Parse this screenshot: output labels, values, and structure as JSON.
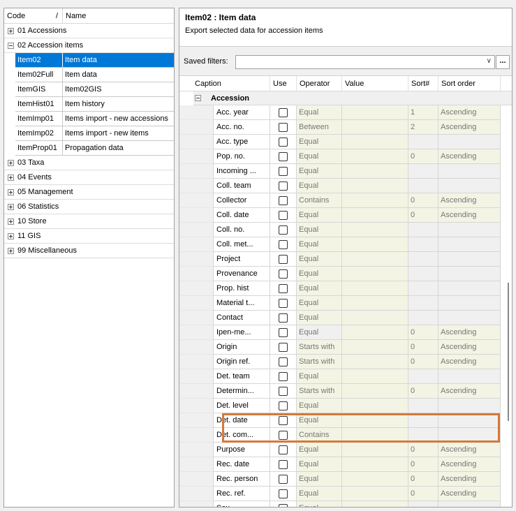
{
  "left_panel": {
    "col_code": "Code",
    "col_sort_mark": "/",
    "col_name": "Name",
    "groups_before": [
      {
        "label": "01 Accessions",
        "expanded": false
      }
    ],
    "expanded_group": {
      "label": "02 Accession items",
      "items": [
        {
          "code": "Item02",
          "name": "Item data",
          "selected": true
        },
        {
          "code": "Item02Full",
          "name": "Item data"
        },
        {
          "code": "ItemGIS",
          "name": "Item02GIS"
        },
        {
          "code": "ItemHist01",
          "name": "Item history"
        },
        {
          "code": "ItemImp01",
          "name": "Items import - new accessions"
        },
        {
          "code": "ItemImp02",
          "name": "Items import - new items"
        },
        {
          "code": "ItemProp01",
          "name": "Propagation data"
        }
      ]
    },
    "groups_after": [
      {
        "label": "03 Taxa"
      },
      {
        "label": "04 Events"
      },
      {
        "label": "05 Management"
      },
      {
        "label": "06 Statistics"
      },
      {
        "label": "10 Store"
      },
      {
        "label": "11 GIS"
      },
      {
        "label": "99 Miscellaneous"
      }
    ]
  },
  "right_panel": {
    "title": "Item02 : Item data",
    "subtitle": "Export selected data for accession items",
    "saved_filters_label": "Saved filters:",
    "more_button": "...",
    "chevron": "∨",
    "grid": {
      "headers": {
        "caption": "Caption",
        "use": "Use",
        "operator": "Operator",
        "value": "Value",
        "sort": "Sort#",
        "order": "Sort order"
      },
      "group": "Accession",
      "rows": [
        {
          "caption": "Acc. year",
          "operator": "Equal",
          "sort": "1",
          "order": "Ascending"
        },
        {
          "caption": "Acc. no.",
          "operator": "Between",
          "sort": "2",
          "order": "Ascending"
        },
        {
          "caption": "Acc. type",
          "operator": "Equal",
          "sort": "",
          "order": ""
        },
        {
          "caption": "Pop. no.",
          "operator": "Equal",
          "sort": "0",
          "order": "Ascending"
        },
        {
          "caption": "Incoming ...",
          "operator": "Equal",
          "sort": "",
          "order": ""
        },
        {
          "caption": "Coll. team",
          "operator": "Equal",
          "sort": "",
          "order": ""
        },
        {
          "caption": "Collector",
          "operator": "Contains",
          "sort": "0",
          "order": "Ascending"
        },
        {
          "caption": "Coll. date",
          "operator": "Equal",
          "sort": "0",
          "order": "Ascending"
        },
        {
          "caption": "Coll. no.",
          "operator": "Equal",
          "sort": "",
          "order": ""
        },
        {
          "caption": "Coll. met...",
          "operator": "Equal",
          "sort": "",
          "order": ""
        },
        {
          "caption": "Project",
          "operator": "Equal",
          "sort": "",
          "order": ""
        },
        {
          "caption": "Provenance",
          "operator": "Equal",
          "sort": "",
          "order": ""
        },
        {
          "caption": "Prop. hist",
          "operator": "Equal",
          "sort": "",
          "order": ""
        },
        {
          "caption": "Material t...",
          "operator": "Equal",
          "sort": "",
          "order": ""
        },
        {
          "caption": "Contact",
          "operator": "Equal",
          "sort": "",
          "order": ""
        },
        {
          "caption": "Ipen-me...",
          "operator": "Equal",
          "sort": "0",
          "order": "Ascending",
          "opgray": true
        },
        {
          "caption": "Origin",
          "operator": "Starts with",
          "sort": "0",
          "order": "Ascending"
        },
        {
          "caption": "Origin ref.",
          "operator": "Starts with",
          "sort": "0",
          "order": "Ascending"
        },
        {
          "caption": "Det. team",
          "operator": "Equal",
          "sort": "",
          "order": ""
        },
        {
          "caption": "Determin...",
          "operator": "Starts with",
          "sort": "0",
          "order": "Ascending"
        },
        {
          "caption": "Det. level",
          "operator": "Equal",
          "sort": "",
          "order": ""
        },
        {
          "caption": "Det. date",
          "operator": "Equal",
          "sort": "",
          "order": ""
        },
        {
          "caption": "Det. com...",
          "operator": "Contains",
          "sort": "",
          "order": ""
        },
        {
          "caption": "Purpose",
          "operator": "Equal",
          "sort": "0",
          "order": "Ascending"
        },
        {
          "caption": "Rec. date",
          "operator": "Equal",
          "sort": "0",
          "order": "Ascending"
        },
        {
          "caption": "Rec. person",
          "operator": "Equal",
          "sort": "0",
          "order": "Ascending"
        },
        {
          "caption": "Rec. ref.",
          "operator": "Equal",
          "sort": "0",
          "order": "Ascending"
        },
        {
          "caption": "Sex",
          "operator": "Equal",
          "sort": "",
          "order": ""
        }
      ]
    }
  },
  "colors": {
    "selection": "#0078d7",
    "highlight_box": "#d3793a",
    "editable_cell": "#f4f4e4"
  }
}
